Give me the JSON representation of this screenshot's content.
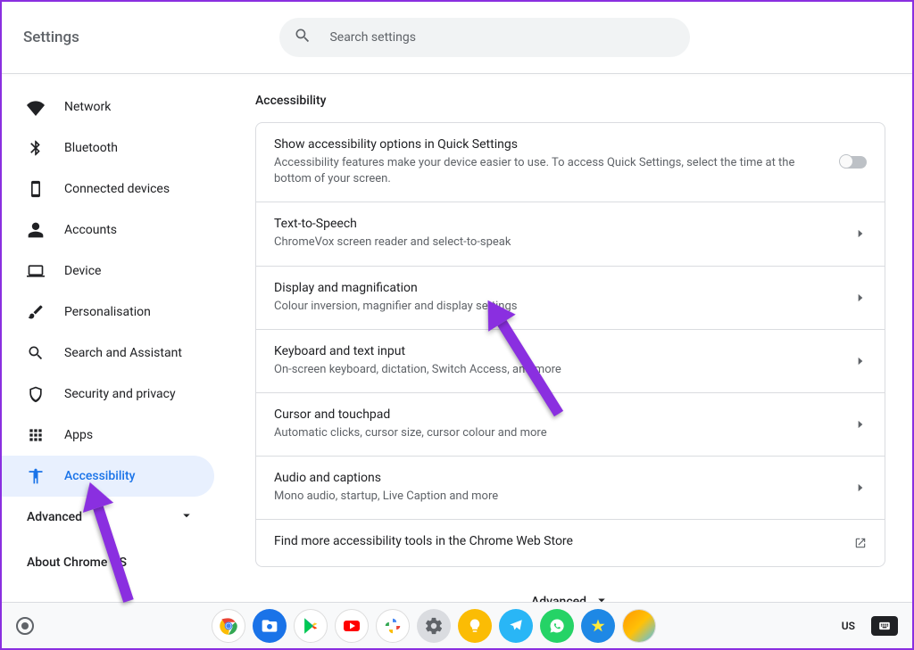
{
  "header": {
    "title": "Settings",
    "search_placeholder": "Search settings"
  },
  "sidebar": {
    "items": [
      {
        "icon": "wifi",
        "label": "Network"
      },
      {
        "icon": "bluetooth",
        "label": "Bluetooth"
      },
      {
        "icon": "devices",
        "label": "Connected devices"
      },
      {
        "icon": "account",
        "label": "Accounts"
      },
      {
        "icon": "laptop",
        "label": "Device"
      },
      {
        "icon": "brush",
        "label": "Personalisation"
      },
      {
        "icon": "search",
        "label": "Search and Assistant"
      },
      {
        "icon": "shield",
        "label": "Security and privacy"
      },
      {
        "icon": "apps",
        "label": "Apps"
      },
      {
        "icon": "a11y",
        "label": "Accessibility"
      }
    ],
    "advanced_label": "Advanced",
    "about_label": "About Chrome OS"
  },
  "page": {
    "title": "Accessibility",
    "rows": [
      {
        "title": "Show accessibility options in Quick Settings",
        "desc": "Accessibility features make your device easier to use. To access Quick Settings, select the time at the bottom of your screen.",
        "action": "toggle"
      },
      {
        "title": "Text-to-Speech",
        "desc": "ChromeVox screen reader and select-to-speak",
        "action": "chevron"
      },
      {
        "title": "Display and magnification",
        "desc": "Colour inversion, magnifier and display settings",
        "action": "chevron"
      },
      {
        "title": "Keyboard and text input",
        "desc": "On-screen keyboard, dictation, Switch Access, and more",
        "action": "chevron"
      },
      {
        "title": "Cursor and touchpad",
        "desc": "Automatic clicks, cursor size, cursor colour and more",
        "action": "chevron"
      },
      {
        "title": "Audio and captions",
        "desc": "Mono audio, startup, Live Caption and more",
        "action": "chevron"
      },
      {
        "title": "Find more accessibility tools in the Chrome Web Store",
        "desc": "",
        "action": "launch"
      }
    ],
    "advanced_button": "Advanced"
  },
  "shelf": {
    "ime_label": "US"
  }
}
